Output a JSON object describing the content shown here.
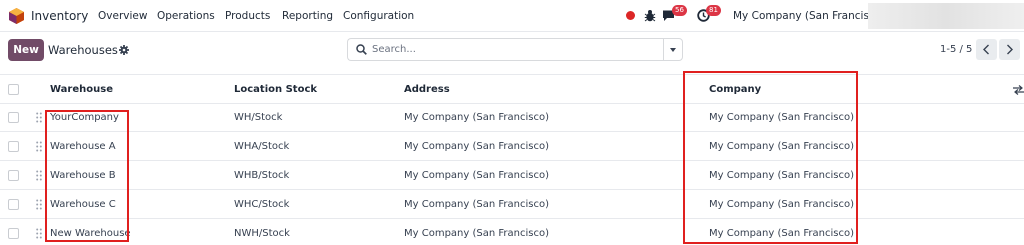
{
  "navbar": {
    "app_name": "Inventory",
    "menu": [
      "Overview",
      "Operations",
      "Products",
      "Reporting",
      "Configuration"
    ],
    "messages_count": "56",
    "activities_count": "81",
    "company": "My Company (San Francisco)"
  },
  "control_panel": {
    "new_label": "New",
    "title": "Warehouses",
    "search_placeholder": "Search...",
    "pager": "1-5 / 5"
  },
  "table": {
    "columns": [
      "Warehouse",
      "Location Stock",
      "Address",
      "Company"
    ],
    "rows": [
      {
        "warehouse": "YourCompany",
        "location_stock": "WH/Stock",
        "address": "My Company (San Francisco)",
        "company": "My Company (San Francisco)"
      },
      {
        "warehouse": "Warehouse A",
        "location_stock": "WHA/Stock",
        "address": "My Company (San Francisco)",
        "company": "My Company (San Francisco)"
      },
      {
        "warehouse": "Warehouse B",
        "location_stock": "WHB/Stock",
        "address": "My Company (San Francisco)",
        "company": "My Company (San Francisco)"
      },
      {
        "warehouse": "Warehouse C",
        "location_stock": "WHC/Stock",
        "address": "My Company (San Francisco)",
        "company": "My Company (San Francisco)"
      },
      {
        "warehouse": "New Warehouse",
        "location_stock": "NWH/Stock",
        "address": "My Company (San Francisco)",
        "company": "My Company (San Francisco)"
      }
    ]
  },
  "colors": {
    "brand": "#714b67",
    "badge": "#dc3545",
    "highlight": "#e0201f",
    "record_dot": "#dc2626"
  },
  "icons": [
    "inventory-logo-icon",
    "record-dot-icon",
    "bug-icon",
    "chat-icon",
    "clock-icon",
    "gear-icon",
    "search-icon",
    "chevron-down-icon",
    "chevron-left-icon",
    "chevron-right-icon",
    "drag-handle-icon",
    "optional-columns-icon"
  ]
}
